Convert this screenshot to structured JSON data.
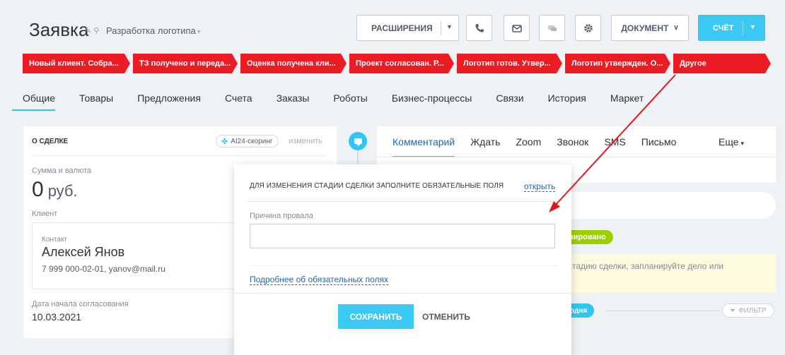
{
  "header": {
    "title": "Заявка",
    "subtitle": "Разработка логотипа",
    "extensions_label": "РАСШИРЕНИЯ",
    "document_label": "ДОКУМЕНТ",
    "bill_label": "СЧЁТ"
  },
  "stages": [
    {
      "label": "Новый клиент. Собра..."
    },
    {
      "label": "ТЗ получено и переда..."
    },
    {
      "label": "Оценка получена кли..."
    },
    {
      "label": "Проект согласован. Р..."
    },
    {
      "label": "Логотип готов. Утвер..."
    },
    {
      "label": "Логотип утвержден. О..."
    },
    {
      "label": "Другое"
    }
  ],
  "tabs": [
    "Общие",
    "Товары",
    "Предложения",
    "Счета",
    "Заказы",
    "Роботы",
    "Бизнес-процессы",
    "Связи",
    "История",
    "Маркет"
  ],
  "about": {
    "heading": "О СДЕЛКЕ",
    "ai_label": "AI24-скоринг",
    "change_label": "изменить",
    "amount_label": "Сумма и валюта",
    "amount": "0",
    "currency": "руб.",
    "client_label": "Клиент",
    "contact_label": "Контакт",
    "contact_name": "Алексей Янов",
    "contact_info": "7 999 000-02-01, yanov@mail.ru",
    "date_label": "Дата начала согласования",
    "date_value": "10.03.2021"
  },
  "activity": {
    "tabs": [
      "Комментарий",
      "Ждать",
      "Zoom",
      "Звонок",
      "SMS",
      "Письмо"
    ],
    "more_label": "Еще",
    "planned_badge": "нировано",
    "hint": "стадию сделки, запланируйте дело или",
    "today_badge": "одня",
    "filter_label": "ФИЛЬТР"
  },
  "modal": {
    "title": "ДЛЯ ИЗМЕНЕНИЯ СТАДИИ СДЕЛКИ ЗАПОЛНИТЕ ОБЯЗАТЕЛЬНЫЕ ПОЛЯ",
    "open_label": "открыть",
    "field_label": "Причина провала",
    "field_value": "",
    "more_link": "Подробнее об обязательных полях",
    "save_label": "СОХРАНИТЬ",
    "cancel_label": "ОТМЕНИТЬ"
  },
  "colors": {
    "accent": "#2fc6f6",
    "stage_red": "#ec1c24",
    "annotation_arrow": "#e0161f",
    "success_green": "#9dcf00"
  }
}
